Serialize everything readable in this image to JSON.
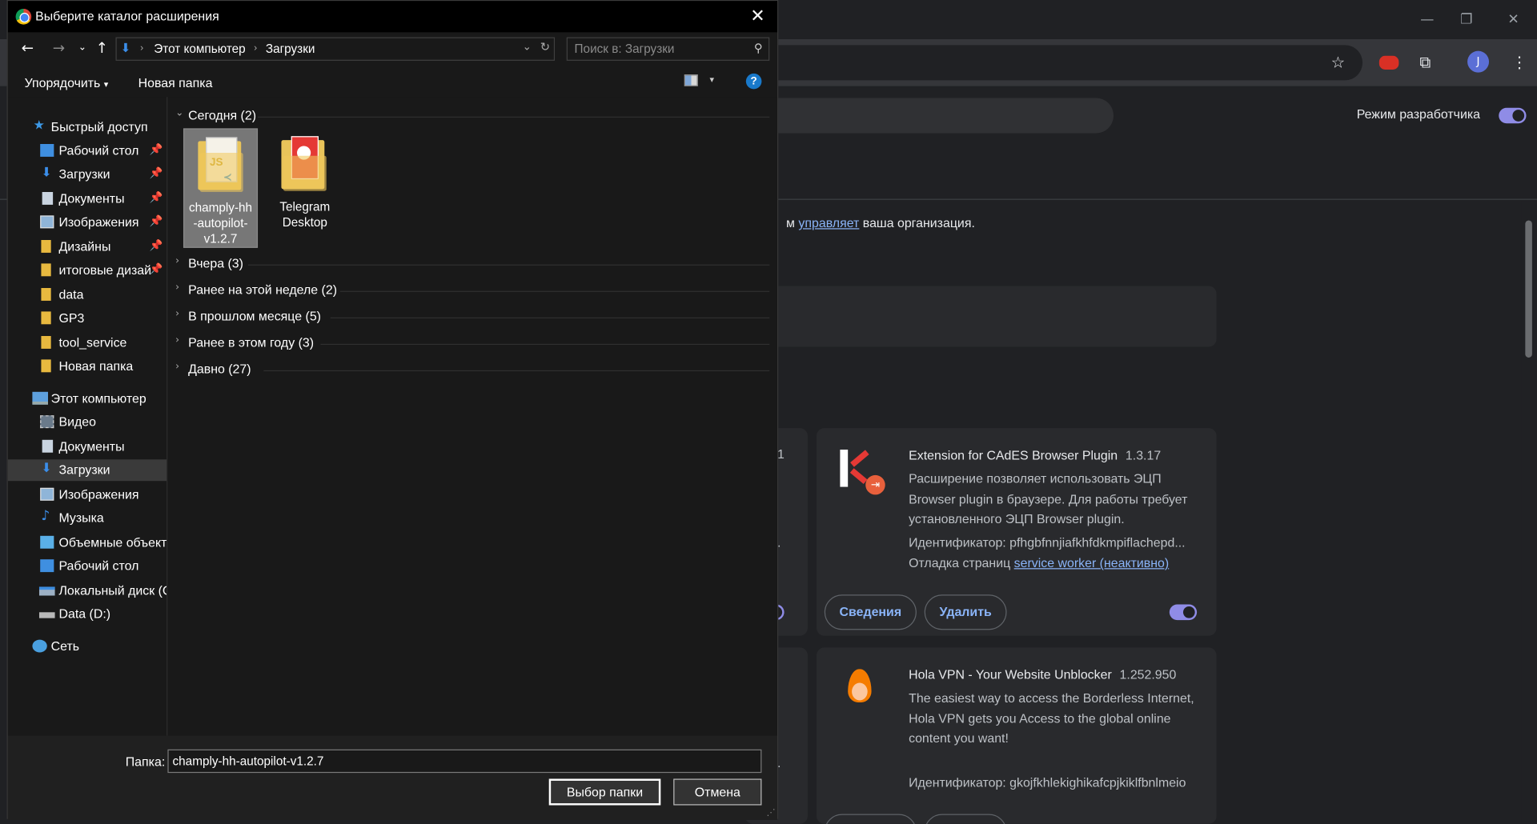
{
  "browser": {
    "dev_mode_label": "Режим разработчика",
    "managed_link": "управляет",
    "managed_text": "ваша организация.",
    "managed_prefix": "м",
    "cards": [
      {
        "title": "Extension for CAdES Browser Plugin",
        "version": "1.3.17",
        "desc": [
          "Расширение позволяет использовать ЭЦП",
          "Browser plugin в браузере. Для работы требует",
          "установленного ЭЦП Browser plugin."
        ],
        "id_line": "Идентификатор: pfhgbfnnjiafkhfdkmpiflachepd...",
        "debug_prefix": "Отладка страниц",
        "debug_link": "service worker (неактивно)",
        "details_btn": "Сведения",
        "remove_btn": "Удалить"
      },
      {
        "title": "Hola VPN - Your Website Unblocker",
        "version": "1.252.950",
        "desc": [
          "The easiest way to access the Borderless Internet,",
          "Hola VPN gets you Access to the global online",
          "content you want!"
        ],
        "id_line": "Идентификатор: gkojfkhlekighikafcpjkiklfbnlmeio"
      }
    ],
    "partial_left": [
      "1",
      "."
    ]
  },
  "dialog": {
    "title": "Выберите каталог расширения",
    "breadcrumb": [
      "Этот компьютер",
      "Загрузки"
    ],
    "search_placeholder": "Поиск в: Загрузки",
    "organize": "Упорядочить",
    "new_folder": "Новая папка",
    "sidebar": {
      "quick_access": "Быстрый доступ",
      "quick_items": [
        "Рабочий стол",
        "Загрузки",
        "Документы",
        "Изображения",
        "Дизайны",
        "итоговые дизай",
        "data",
        "GP3",
        "tool_service",
        "Новая папка"
      ],
      "this_pc": "Этот компьютер",
      "pc_items": [
        "Видео",
        "Документы",
        "Загрузки",
        "Изображения",
        "Музыка",
        "Объемные объекты",
        "Рабочий стол",
        "Локальный диск (C",
        "Data (D:)"
      ],
      "network": "Сеть"
    },
    "groups": {
      "today": "Сегодня (2)",
      "yesterday": "Вчера (3)",
      "this_week": "Ранее на этой неделе (2)",
      "last_month": "В прошлом месяце (5)",
      "this_year": "Ранее в этом году (3)",
      "long_ago": "Давно (27)"
    },
    "files": [
      {
        "name_lines": [
          "champly-hh",
          "-autopilot-",
          "v1.2.7"
        ]
      },
      {
        "name_lines": [
          "Telegram",
          "Desktop"
        ]
      }
    ],
    "folder_label": "Папка:",
    "folder_value": "champly-hh-autopilot-v1.2.7",
    "select_btn": "Выбор папки",
    "cancel_btn": "Отмена"
  }
}
